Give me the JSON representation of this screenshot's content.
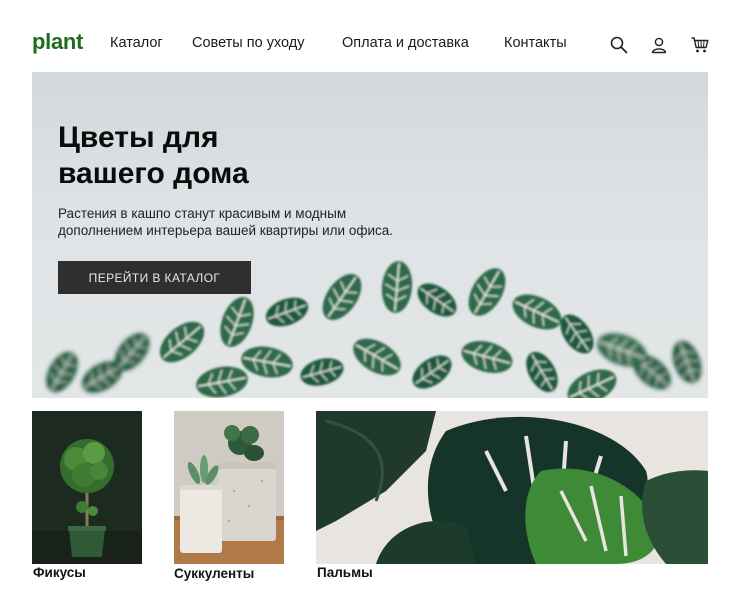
{
  "header": {
    "logo": "plant",
    "nav": [
      "Каталог",
      "Советы по уходу",
      "Оплата и доставка",
      "Контакты"
    ],
    "icons": [
      "search-icon",
      "user-icon",
      "cart-icon"
    ]
  },
  "hero": {
    "title_line1": "Цветы для",
    "title_line2": "вашего дома",
    "text_line1": "Растения в кашпо станут красивым и модным",
    "text_line2": "дополнением интерьера вашей квартиры или офиса.",
    "button": "ПЕРЕЙТИ В КАТАЛОГ"
  },
  "categories": [
    {
      "label": "Фикусы"
    },
    {
      "label": "Суккуленты"
    },
    {
      "label": "Пальмы"
    }
  ],
  "colors": {
    "logo": "#1f6b1f",
    "button_bg": "#2f2f2f",
    "leaf_dark": "#1f4a33",
    "leaf_mid": "#2e6b48"
  }
}
